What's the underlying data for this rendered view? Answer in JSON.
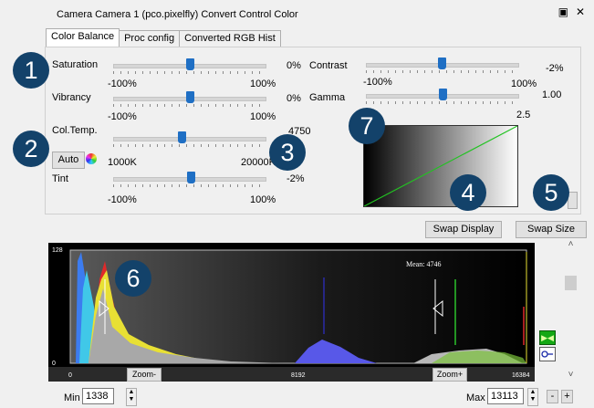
{
  "window": {
    "title": "Camera Camera 1 (pco.pixelfly) Convert Control Color",
    "controls": [
      "▣",
      "✕"
    ]
  },
  "tabs": [
    {
      "label": "Color Balance",
      "active": true
    },
    {
      "label": "Proc config",
      "active": false
    },
    {
      "label": "Converted RGB Hist",
      "active": false
    }
  ],
  "sliders": {
    "saturation": {
      "label": "Saturation",
      "min": "-100%",
      "max": "100%",
      "value": "0%",
      "position": 0.5
    },
    "vibrancy": {
      "label": "Vibrancy",
      "min": "-100%",
      "max": "100%",
      "value": "0%",
      "position": 0.5
    },
    "coltemp": {
      "label": "Col.Temp.",
      "min": "1000K",
      "max": "20000K",
      "value": "4750",
      "position": 0.45
    },
    "tint": {
      "label": "Tint",
      "min": "-100%",
      "max": "100%",
      "value": "-2%",
      "position": 0.49
    },
    "contrast": {
      "label": "Contrast",
      "min": "-100%",
      "max": "100%",
      "value": "-2%",
      "position": 0.49
    },
    "gamma": {
      "label": "Gamma",
      "min": "",
      "max": "2.5",
      "value": "1.00",
      "position": 0.5
    }
  },
  "buttons": {
    "auto": "Auto",
    "swap_display": "Swap Display",
    "swap_size": "Swap Size",
    "zoom_minus": "Zoom-",
    "zoom_plus": "Zoom+"
  },
  "badges": [
    "1",
    "2",
    "3",
    "4",
    "5",
    "6",
    "7"
  ],
  "histogram": {
    "y_max_label": "128",
    "y_min_label": "0",
    "x_labels": [
      "0",
      "8192",
      "16384"
    ],
    "mean_label": "Mean: 4746"
  },
  "footer": {
    "min_label": "Min",
    "min_value": "1338",
    "max_label": "Max",
    "max_value": "13113"
  },
  "colors": {
    "badge": "#13426a",
    "slider_thumb": "#1f6fc4",
    "gamma_curve": "#22c322"
  }
}
